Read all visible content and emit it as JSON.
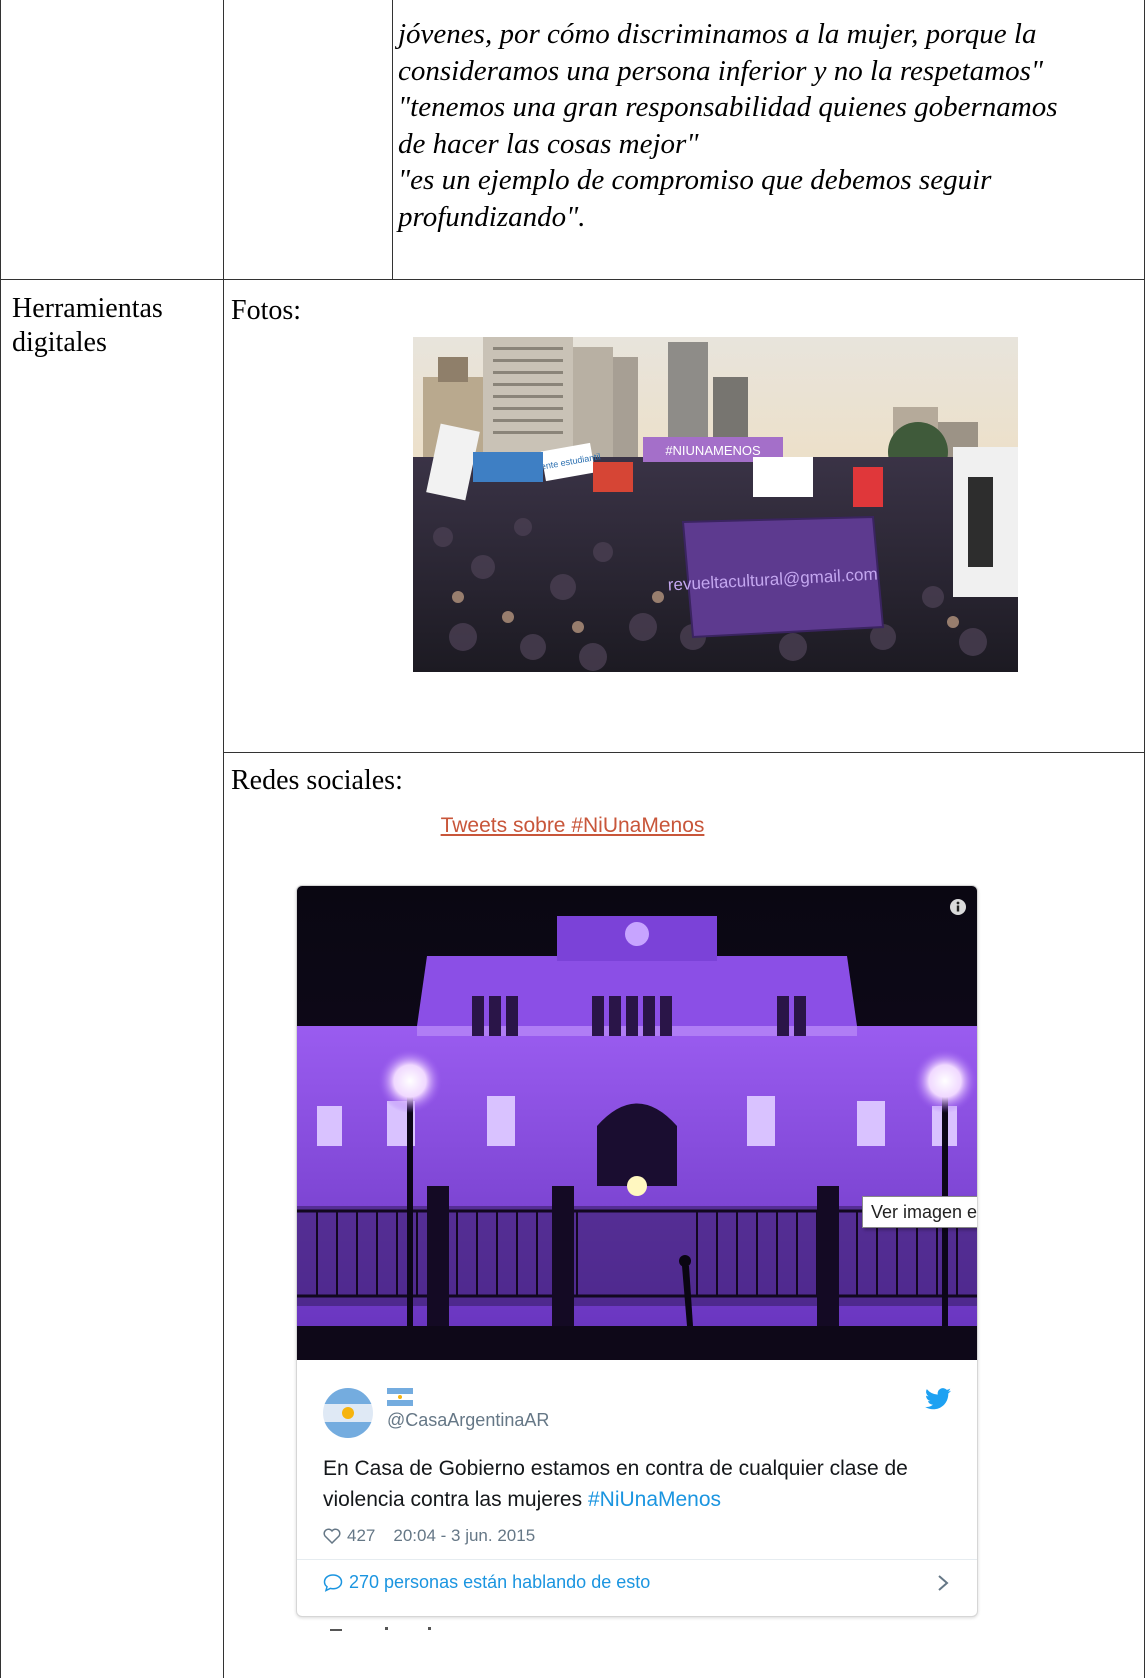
{
  "quote_lines": [
    "jóvenes, por cómo discriminamos a la mujer, porque la",
    "consideramos una persona inferior y no la respetamos\"",
    "\"tenemos una gran responsabilidad quienes gobernamos",
    "de hacer las cosas mejor\"",
    "\"es un ejemplo de compromiso que debemos seguir",
    "profundizando\"."
  ],
  "row_label": [
    "Herramientas",
    "digitales"
  ],
  "photos_label": "Fotos:",
  "social_label": "Redes sociales:",
  "tweets_link": "Tweets sobre #NiUnaMenos",
  "photo_crowd_banners": [
    "#NIUNAMENOS",
    "revueltacultural@gmail.com",
    "frente estudiantil"
  ],
  "tooltip": "Ver imagen en",
  "tweet": {
    "handle": "@CasaArgentinaAR",
    "text": "En Casa de Gobierno estamos en contra de cualquier clase de violencia contra las mujeres",
    "hashtag": "#NiUnaMenos",
    "likes": "427",
    "timestamp": "20:04 - 3 jun. 2015",
    "conversation": "270 personas están hablando de esto"
  },
  "colors": {
    "link": "#c8563a",
    "twitter_blue": "#1b95e0",
    "palace_purple": "#8a4fe0"
  }
}
